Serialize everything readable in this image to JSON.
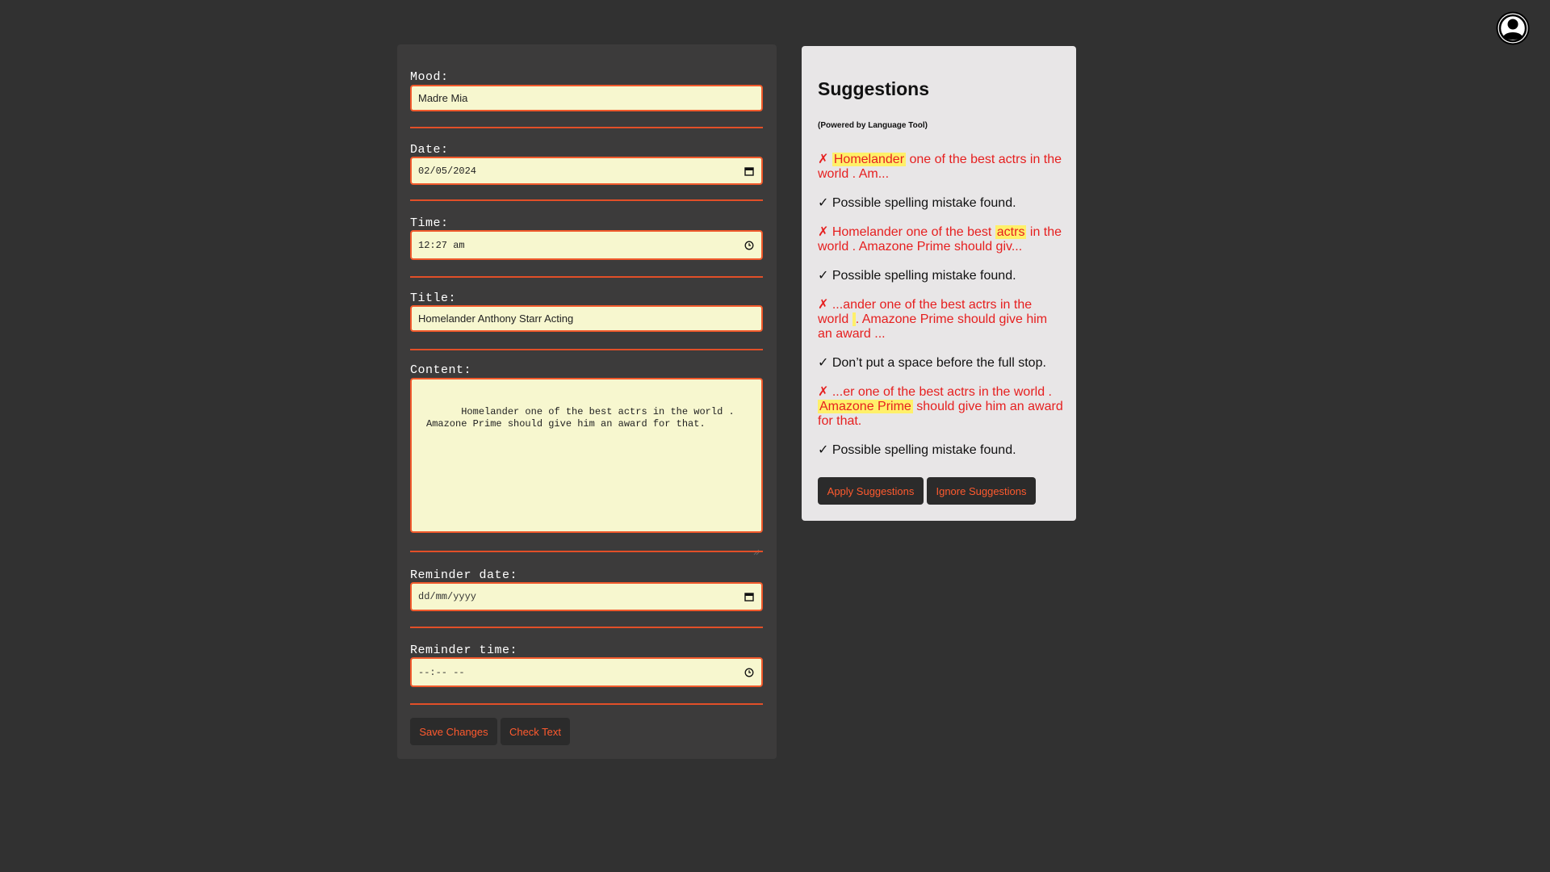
{
  "form": {
    "mood": {
      "label": "Mood:",
      "value": "Madre Mia"
    },
    "date": {
      "label": "Date:",
      "value": "02/05/2024"
    },
    "time": {
      "label": "Time:",
      "value": "12:27 am"
    },
    "title": {
      "label": "Title:",
      "value": "Homelander Anthony Starr Acting"
    },
    "content": {
      "label": "Content:",
      "value": "Homelander one of the best actrs in the world .\nAmazone Prime should give him an award for that."
    },
    "reminder_date": {
      "label": "Reminder date:",
      "placeholder": "dd/mm/yyyy"
    },
    "reminder_time": {
      "label": "Reminder time:",
      "placeholder": "--:-- --"
    },
    "save_label": "Save Changes",
    "check_label": "Check Text"
  },
  "suggestions": {
    "title": "Suggestions",
    "powered": "(Powered by Language Tool)",
    "items": [
      {
        "mark": "✗",
        "pre": " ",
        "highlight": "Homelander",
        "post": " one of the best actrs in the world . Am...",
        "message": "✓ Possible spelling mistake found."
      },
      {
        "mark": "✗",
        "pre": " Homelander one of the best ",
        "highlight": "actrs",
        "post": " in the world . Amazone Prime should giv...",
        "message": "✓ Possible spelling mistake found."
      },
      {
        "mark": "✗",
        "pre": " ...ander one of the best actrs in the world ",
        "highlight": " ",
        "post": ". Amazone Prime should give him an award ...",
        "message": "✓ Don’t put a space before the full stop."
      },
      {
        "mark": "✗",
        "pre": " ...er one of the best actrs in the world . ",
        "highlight": "Amazone Prime",
        "post": " should give him an award for that.",
        "message": "✓ Possible spelling mistake found."
      }
    ],
    "apply_label": "Apply Suggestions",
    "ignore_label": "Ignore Suggestions"
  },
  "colors": {
    "background": "#313131",
    "panel": "#3c3b3b",
    "accent": "#f15a2c",
    "input_bg": "#f7f7cf",
    "error_text": "#e61f1f",
    "highlight": "#fff06a"
  },
  "icons": {
    "avatar": "user-circle-icon",
    "calendar": "calendar-icon",
    "clock": "clock-icon"
  }
}
